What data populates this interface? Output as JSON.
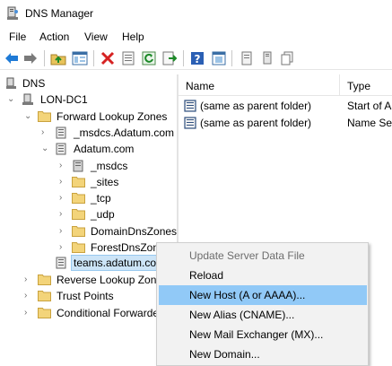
{
  "window": {
    "title": "DNS Manager",
    "app_icon": "dns-server-icon"
  },
  "menu": [
    "File",
    "Action",
    "View",
    "Help"
  ],
  "toolbar": {
    "buttons": [
      "back-arrow-icon",
      "forward-arrow-icon",
      "up-folder-icon",
      "show-hide-tree-icon",
      "delete-icon",
      "properties-icon",
      "refresh-icon",
      "export-list-icon",
      "help-icon",
      "mmc-snapin-icon",
      "view-records-icon",
      "copy-icon"
    ]
  },
  "tree": {
    "root": "DNS",
    "server": "LON-DC1",
    "forward_zones": "Forward Lookup Zones",
    "msdcs_zone": "_msdcs.Adatum.com",
    "adatum_zone": "Adatum.com",
    "sub_msdcs": "_msdcs",
    "sub_sites": "_sites",
    "sub_tcp": "_tcp",
    "sub_udp": "_udp",
    "sub_domaindns": "DomainDnsZones",
    "sub_forestdns": "ForestDnsZones",
    "teams_zone": "teams.adatum.com",
    "reverse_zones": "Reverse Lookup Zones",
    "trust_points": "Trust Points",
    "conditional_forwarders": "Conditional Forwarders"
  },
  "list": {
    "col_name": "Name",
    "col_type": "Type",
    "rows": [
      {
        "name": "(same as parent folder)",
        "type": "Start of Authority (SOA)"
      },
      {
        "name": "(same as parent folder)",
        "type": "Name Server (NS)"
      }
    ]
  },
  "context_menu": {
    "update_server": "Update Server Data File",
    "reload": "Reload",
    "new_host": "New Host (A or AAAA)...",
    "new_alias": "New Alias (CNAME)...",
    "new_mx": "New Mail Exchanger (MX)...",
    "new_domain": "New Domain..."
  }
}
